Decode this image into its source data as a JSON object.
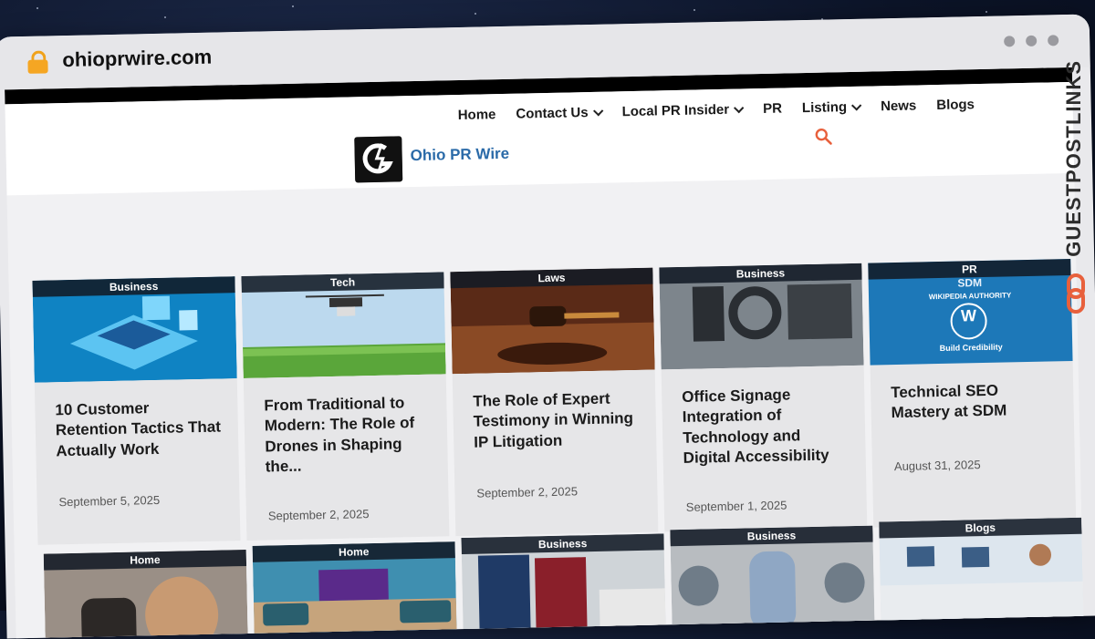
{
  "browser": {
    "url": "ohioprwire.com"
  },
  "nav": {
    "items": [
      {
        "label": "Home",
        "dropdown": false
      },
      {
        "label": "Contact Us",
        "dropdown": true
      },
      {
        "label": "Local PR Insider",
        "dropdown": true
      },
      {
        "label": "PR",
        "dropdown": false
      },
      {
        "label": "Listing",
        "dropdown": true
      },
      {
        "label": "News",
        "dropdown": false
      },
      {
        "label": "Blogs",
        "dropdown": false
      }
    ]
  },
  "site": {
    "name": "Ohio PR Wire"
  },
  "watermark": {
    "text": "GUESTPOSTLINKS"
  },
  "colors": {
    "accent": "#2a6aa8",
    "search": "#e8603c",
    "tag_bg": "#121a26"
  },
  "cards_row1": [
    {
      "tag": "Business",
      "title": "10 Customer Retention Tactics That Actually Work",
      "date": "September 5, 2025"
    },
    {
      "tag": "Tech",
      "title": "From Traditional to Modern: The Role of Drones in Shaping the...",
      "date": "September 2, 2025"
    },
    {
      "tag": "Laws",
      "title": "The Role of Expert Testimony in Winning IP Litigation",
      "date": "September 2, 2025"
    },
    {
      "tag": "Business",
      "title": "Office Signage Integration of Technology and Digital Accessibility",
      "date": "September 1, 2025"
    },
    {
      "tag": "PR",
      "title": "Technical SEO Mastery at SDM",
      "date": "August 31, 2025",
      "thumb_text": [
        "SDM",
        "WIKIPEDIA AUTHORITY",
        "W",
        "Build Credibility"
      ]
    }
  ],
  "cards_row2": [
    {
      "tag": "Home"
    },
    {
      "tag": "Home"
    },
    {
      "tag": "Business"
    },
    {
      "tag": "Business"
    },
    {
      "tag": "Blogs"
    }
  ]
}
